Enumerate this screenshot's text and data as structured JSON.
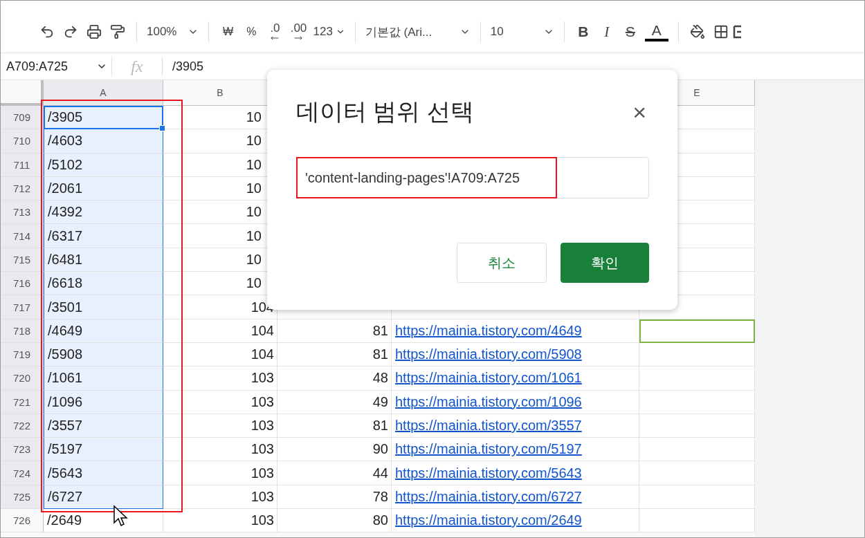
{
  "toolbar": {
    "zoom": "100%",
    "currency": "₩",
    "percent": "%",
    "decrease_decimals": ".0",
    "increase_decimals": ".00",
    "number_format": "123",
    "font": "기본값 (Ari...",
    "font_size": "10",
    "bold": "B",
    "italic": "I",
    "strikethrough": "S",
    "text_color": "A"
  },
  "formula_bar": {
    "name_box": "A709:A725",
    "fx": "fx",
    "value": "/3905"
  },
  "columns": [
    {
      "label": "A",
      "selected": true
    },
    {
      "label": "B",
      "selected": false
    },
    {
      "label": "E",
      "selected": false
    }
  ],
  "rows": [
    {
      "number": "709",
      "selected": true,
      "active": true,
      "a": "/3905",
      "b": "10",
      "e_outlined": false
    },
    {
      "number": "710",
      "selected": true,
      "active": false,
      "a": "/4603",
      "b": "10",
      "e_outlined": false
    },
    {
      "number": "711",
      "selected": true,
      "active": false,
      "a": "/5102",
      "b": "10",
      "e_outlined": false
    },
    {
      "number": "712",
      "selected": true,
      "active": false,
      "a": "/2061",
      "b": "10",
      "e_outlined": false
    },
    {
      "number": "713",
      "selected": true,
      "active": false,
      "a": "/4392",
      "b": "10",
      "e_outlined": false
    },
    {
      "number": "714",
      "selected": true,
      "active": false,
      "a": "/6317",
      "b": "10",
      "e_outlined": false
    },
    {
      "number": "715",
      "selected": true,
      "active": false,
      "a": "/6481",
      "b": "10",
      "e_outlined": false
    },
    {
      "number": "716",
      "selected": true,
      "active": false,
      "a": "/6618",
      "b": "10",
      "e_outlined": false
    },
    {
      "number": "717",
      "selected": true,
      "active": false,
      "a": "/3501",
      "b": "104",
      "e_outlined": false
    },
    {
      "number": "718",
      "selected": true,
      "active": false,
      "a": "/4649",
      "b": "104",
      "c": "81",
      "d": "https://mainia.tistory.com/4649",
      "e_outlined": true
    },
    {
      "number": "719",
      "selected": true,
      "active": false,
      "a": "/5908",
      "b": "104",
      "c": "81",
      "d": "https://mainia.tistory.com/5908",
      "e_outlined": false
    },
    {
      "number": "720",
      "selected": true,
      "active": false,
      "a": "/1061",
      "b": "103",
      "c": "48",
      "d": "https://mainia.tistory.com/1061",
      "e_outlined": false
    },
    {
      "number": "721",
      "selected": true,
      "active": false,
      "a": "/1096",
      "b": "103",
      "c": "49",
      "d": "https://mainia.tistory.com/1096",
      "e_outlined": false
    },
    {
      "number": "722",
      "selected": true,
      "active": false,
      "a": "/3557",
      "b": "103",
      "c": "81",
      "d": "https://mainia.tistory.com/3557",
      "e_outlined": false
    },
    {
      "number": "723",
      "selected": true,
      "active": false,
      "a": "/5197",
      "b": "103",
      "c": "90",
      "d": "https://mainia.tistory.com/5197",
      "e_outlined": false
    },
    {
      "number": "724",
      "selected": true,
      "active": false,
      "a": "/5643",
      "b": "103",
      "c": "44",
      "d": "https://mainia.tistory.com/5643",
      "e_outlined": false
    },
    {
      "number": "725",
      "selected": true,
      "active": false,
      "a": "/6727",
      "b": "103",
      "c": "78",
      "d": "https://mainia.tistory.com/6727",
      "e_outlined": false
    },
    {
      "number": "726",
      "selected": false,
      "active": false,
      "a": "/2649",
      "b": "103",
      "c": "80",
      "d": "https://mainia.tistory.com/2649",
      "e_outlined": false
    }
  ],
  "dialog": {
    "title": "데이터 범위 선택",
    "close": "×",
    "range": "'content-landing-pages'!A709:A725",
    "cancel": "취소",
    "ok": "확인"
  }
}
